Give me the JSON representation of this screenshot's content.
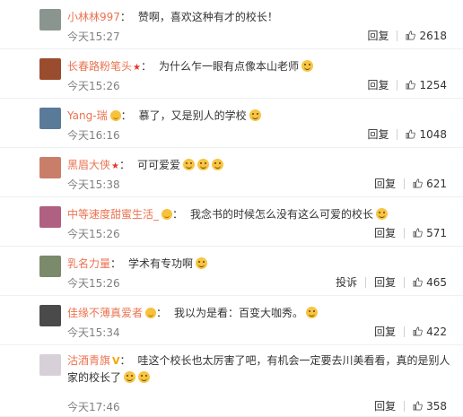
{
  "comments": [
    {
      "name": "小林林997",
      "badge": "",
      "text": "赞啊，喜欢这种有才的校长！",
      "emojis": 0,
      "time": "今天15:27",
      "actions": [
        "回复"
      ],
      "likes": "2618",
      "avatar_color": "#8a9590"
    },
    {
      "name": "长春路粉笔头",
      "badge": "star",
      "text": "为什么乍一眼有点像本山老师",
      "emojis": 1,
      "time": "今天15:26",
      "actions": [
        "回复"
      ],
      "likes": "1254",
      "avatar_color": "#9a4d2e"
    },
    {
      "name": "Yang-瑞",
      "badge": "smile",
      "text": "慕了，又是别人的学校",
      "emojis": 1,
      "time": "今天16:16",
      "actions": [
        "回复"
      ],
      "likes": "1048",
      "avatar_color": "#5a7a9a"
    },
    {
      "name": "黑眉大侠",
      "badge": "star",
      "text": "可可爱爱",
      "emojis": 3,
      "time": "今天15:38",
      "actions": [
        "回复"
      ],
      "likes": "621",
      "avatar_color": "#c97e6a"
    },
    {
      "name": "中等速度甜蜜生活_",
      "badge": "smile",
      "text": "我念书的时候怎么没有这么可爱的校长",
      "emojis": 1,
      "time": "今天15:26",
      "actions": [
        "回复"
      ],
      "likes": "571",
      "avatar_color": "#b06080"
    },
    {
      "name": "乳名力量",
      "badge": "",
      "text": "学术有专功啊",
      "emojis": 1,
      "time": "今天15:26",
      "actions": [
        "投诉",
        "回复"
      ],
      "likes": "465",
      "avatar_color": "#7a8a6a"
    },
    {
      "name": "佳缘不薄真爱者",
      "badge": "smile",
      "text": "我以为是看：百变大咖秀。",
      "emojis": 1,
      "time": "今天15:34",
      "actions": [
        "回复"
      ],
      "likes": "422",
      "avatar_color": "#4a4a4a"
    },
    {
      "name": "沽酒青旗",
      "badge": "v",
      "text": "哇这个校长也太厉害了吧，有机会一定要去川美看看，真的是别人家的校长了",
      "emojis": 2,
      "time": "今天17:46",
      "actions": [
        "回复"
      ],
      "likes": "358",
      "avatar_color": "#d8d0d8"
    }
  ],
  "colors": {
    "name": "#eb7350",
    "time": "#808080",
    "divider": "#eef0f2"
  },
  "icons": {
    "like": "thumbs-up-icon",
    "star": "star-badge-icon",
    "smile": "member-smile-icon",
    "v": "v-badge-icon"
  }
}
